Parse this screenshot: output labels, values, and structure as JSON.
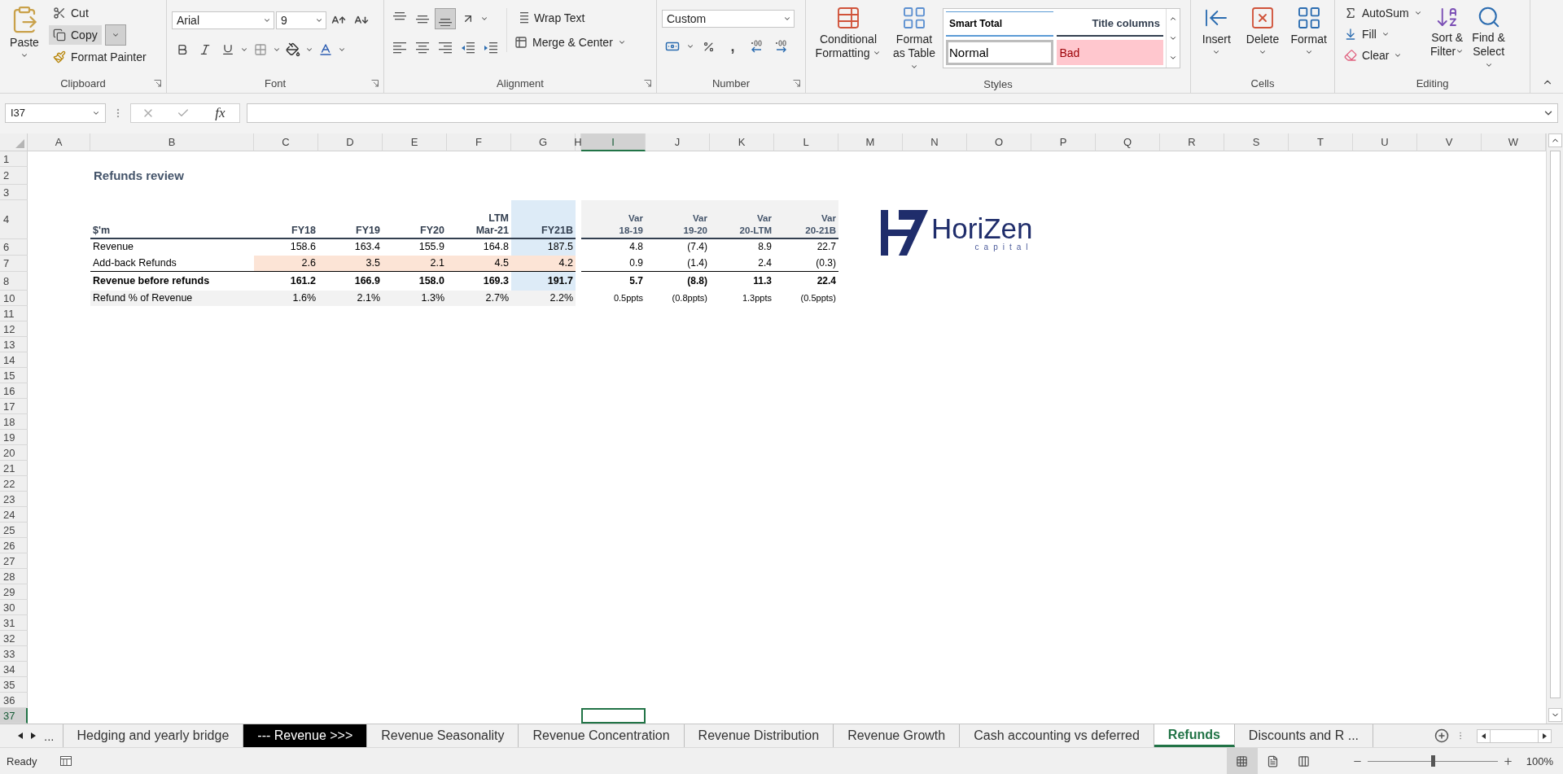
{
  "ribbon": {
    "clipboard": {
      "label": "Clipboard",
      "paste": "Paste",
      "cut": "Cut",
      "copy": "Copy",
      "format_painter": "Format Painter"
    },
    "font": {
      "label": "Font",
      "font_name": "Arial",
      "font_size": "9"
    },
    "alignment": {
      "label": "Alignment",
      "vertical_align": [
        {
          "selected": false
        },
        {
          "selected": false
        },
        {
          "selected": true
        }
      ],
      "wrap_text": "Wrap Text",
      "merge": "Merge & Center"
    },
    "number": {
      "label": "Number",
      "format": "Custom",
      "comma": ","
    },
    "styles": {
      "label": "Styles",
      "buttons": [
        "Conditional Formatting",
        "Format as Table"
      ],
      "gallery": [
        {
          "label": "Smart Total",
          "kind": "total",
          "selected": false
        },
        {
          "label": "Title columns",
          "kind": "title",
          "selected": false
        },
        {
          "label": "Normal",
          "kind": "normal",
          "selected": true
        },
        {
          "label": "Bad",
          "kind": "bad",
          "selected": false
        }
      ]
    },
    "cells": {
      "label": "Cells",
      "buttons": [
        "Insert",
        "Delete",
        "Format"
      ]
    },
    "editing": {
      "label": "Editing",
      "autosum": "AutoSum",
      "fill": "Fill",
      "clear": "Clear",
      "sort": "Sort & Filter",
      "find": "Find & Select"
    }
  },
  "formula_bar": {
    "name_box": "I37",
    "fx": "fx"
  },
  "sheet": {
    "columns": [
      {
        "label": "A",
        "selected": false
      },
      {
        "label": "B",
        "selected": false
      },
      {
        "label": "C",
        "selected": false
      },
      {
        "label": "D",
        "selected": false
      },
      {
        "label": "E",
        "selected": false
      },
      {
        "label": "F",
        "selected": false
      },
      {
        "label": "G",
        "selected": false
      },
      {
        "label": "H",
        "selected": false
      },
      {
        "label": "I",
        "selected": true
      },
      {
        "label": "J",
        "selected": false
      },
      {
        "label": "K",
        "selected": false
      },
      {
        "label": "L",
        "selected": false
      },
      {
        "label": "M",
        "selected": false
      },
      {
        "label": "N",
        "selected": false
      },
      {
        "label": "O",
        "selected": false
      },
      {
        "label": "P",
        "selected": false
      },
      {
        "label": "Q",
        "selected": false
      },
      {
        "label": "R",
        "selected": false
      },
      {
        "label": "S",
        "selected": false
      },
      {
        "label": "T",
        "selected": false
      },
      {
        "label": "U",
        "selected": false
      },
      {
        "label": "V",
        "selected": false
      },
      {
        "label": "W",
        "selected": false
      }
    ],
    "rows": [
      {
        "label": "1",
        "selected": false
      },
      {
        "label": "2",
        "selected": false
      },
      {
        "label": "3",
        "selected": false
      },
      {
        "label": "4",
        "selected": false
      },
      {
        "label": "6",
        "selected": false
      },
      {
        "label": "7",
        "selected": false
      },
      {
        "label": "8",
        "selected": false
      },
      {
        "label": "10",
        "selected": false
      },
      {
        "label": "11",
        "selected": false
      },
      {
        "label": "12",
        "selected": false
      },
      {
        "label": "13",
        "selected": false
      },
      {
        "label": "14",
        "selected": false
      },
      {
        "label": "15",
        "selected": false
      },
      {
        "label": "16",
        "selected": false
      },
      {
        "label": "17",
        "selected": false
      },
      {
        "label": "18",
        "selected": false
      },
      {
        "label": "19",
        "selected": false
      },
      {
        "label": "20",
        "selected": false
      },
      {
        "label": "21",
        "selected": false
      },
      {
        "label": "22",
        "selected": false
      },
      {
        "label": "23",
        "selected": false
      },
      {
        "label": "24",
        "selected": false
      },
      {
        "label": "25",
        "selected": false
      },
      {
        "label": "26",
        "selected": false
      },
      {
        "label": "27",
        "selected": false
      },
      {
        "label": "28",
        "selected": false
      },
      {
        "label": "29",
        "selected": false
      },
      {
        "label": "30",
        "selected": false
      },
      {
        "label": "31",
        "selected": false
      },
      {
        "label": "32",
        "selected": false
      },
      {
        "label": "33",
        "selected": false
      },
      {
        "label": "34",
        "selected": false
      },
      {
        "label": "35",
        "selected": false
      },
      {
        "label": "36",
        "selected": false
      },
      {
        "label": "37",
        "selected": true
      }
    ],
    "title": "Refunds review",
    "table": {
      "unit": "$'m",
      "periods": [
        {
          "label": "FY18",
          "highlighted": false
        },
        {
          "label": "FY19",
          "highlighted": false
        },
        {
          "label": "FY20",
          "highlighted": false
        },
        {
          "top": "LTM",
          "label": "Mar-21",
          "highlighted": false
        },
        {
          "label": "FY21B",
          "highlighted": true
        }
      ],
      "variances": [
        {
          "top": "Var",
          "label": "18-19"
        },
        {
          "top": "Var",
          "label": "19-20"
        },
        {
          "top": "Var",
          "label": "20-LTM"
        },
        {
          "top": "Var",
          "label": "20-21B"
        }
      ],
      "lines": [
        {
          "label": "Revenue",
          "kind": "normal",
          "values": [
            "158.6",
            "163.4",
            "155.9",
            "164.8",
            "187.5"
          ],
          "variances": [
            "4.8",
            "(7.4)",
            "8.9",
            "22.7"
          ]
        },
        {
          "label": "Add-back Refunds",
          "kind": "input",
          "values": [
            "2.6",
            "3.5",
            "2.1",
            "4.5",
            "4.2"
          ],
          "variances": [
            "0.9",
            "(1.4)",
            "2.4",
            "(0.3)"
          ]
        },
        {
          "label": "Revenue before refunds",
          "kind": "total",
          "values": [
            "161.2",
            "166.9",
            "158.0",
            "169.3",
            "191.7"
          ],
          "variances": [
            "5.7",
            "(8.8)",
            "11.3",
            "22.4"
          ]
        },
        {
          "label": "Refund % of Revenue",
          "kind": "ratio",
          "values": [
            "1.6%",
            "2.1%",
            "1.3%",
            "2.7%",
            "2.2%"
          ],
          "variances": [
            "0.5ppts",
            "(0.8ppts)",
            "1.3ppts",
            "(0.5ppts)"
          ]
        }
      ]
    },
    "logo": {
      "name": "HoriZen",
      "tagline": "capital"
    }
  },
  "sheet_tabs": {
    "more": "...",
    "items": [
      {
        "label": "Hedging and yearly bridge",
        "kind": "normal",
        "selected": false
      },
      {
        "label": "--- Revenue >>>",
        "kind": "dark",
        "selected": false
      },
      {
        "label": "Revenue Seasonality",
        "kind": "normal",
        "selected": false
      },
      {
        "label": "Revenue Concentration",
        "kind": "normal",
        "selected": false
      },
      {
        "label": "Revenue Distribution",
        "kind": "normal",
        "selected": false
      },
      {
        "label": "Revenue Growth",
        "kind": "normal",
        "selected": false
      },
      {
        "label": "Cash accounting vs deferred",
        "kind": "normal",
        "selected": false
      },
      {
        "label": "Refunds",
        "kind": "normal",
        "selected": true
      },
      {
        "label": "Discounts and R ...",
        "kind": "normal",
        "selected": false
      }
    ]
  },
  "status_bar": {
    "text": "Ready",
    "views": [
      {
        "selected": true
      },
      {
        "selected": false
      },
      {
        "selected": false
      }
    ],
    "zoom_slider": {
      "level": 0.5
    },
    "zoom": "100%"
  }
}
